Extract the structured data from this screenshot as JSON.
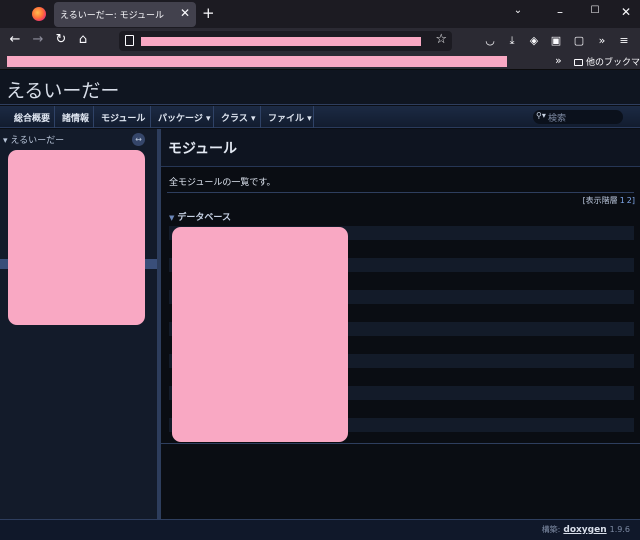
{
  "browser": {
    "tab_title": "えるいーだー: モジュール",
    "tab_close": "✕",
    "new_tab": "+",
    "window": {
      "minimize": "–",
      "maximize": "☐",
      "close": "✕"
    },
    "nav": {
      "back": "←",
      "forward": "→",
      "reload": "↻",
      "home": "⌂"
    },
    "url_star": "☆",
    "toolbar_icons": [
      "pocket-icon",
      "download-icon",
      "shield-extension-icon",
      "extension-icon",
      "extension-icon-2",
      "overflow-icon",
      "menu-icon"
    ],
    "toolbar_glyphs": [
      "◡",
      "⤓",
      "◈",
      "▣",
      "▢",
      "»",
      "≡"
    ],
    "bookmarks": {
      "more": "»",
      "other_folder": "他のブックマーク"
    }
  },
  "doxygen": {
    "project_name": "えるいーだー",
    "menu": [
      {
        "label": "総合概要"
      },
      {
        "label": "諸情報"
      },
      {
        "label": "モジュール"
      },
      {
        "label": "パッケージ ▾"
      },
      {
        "label": "クラス ▾"
      },
      {
        "label": "ファイル ▾"
      }
    ],
    "search": {
      "icon": "⚲▾",
      "placeholder": "検索"
    },
    "sidebar": {
      "root_item": "▾ えるいーだー",
      "sync_icon": "↔"
    },
    "page_title": "モジュール",
    "intro": "全モジュールの一覧です。",
    "levels": {
      "label": "[表示階層",
      "level_1": "1",
      "level_2": "2]"
    },
    "directory": {
      "arrow": "▼",
      "title": "データベース"
    },
    "footer": {
      "prefix": "構築:",
      "brand": "doxygen",
      "version": "1.9.6"
    }
  },
  "colors": {
    "redaction": "#f9a8c3",
    "page_bg": "#0b0e14",
    "menu_text": "#dfe6f1"
  }
}
